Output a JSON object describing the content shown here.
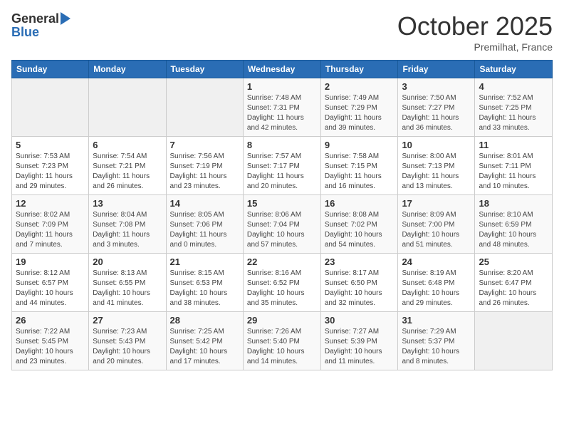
{
  "header": {
    "logo_general": "General",
    "logo_blue": "Blue",
    "month_title": "October 2025",
    "location": "Premilhat, France"
  },
  "days_of_week": [
    "Sunday",
    "Monday",
    "Tuesday",
    "Wednesday",
    "Thursday",
    "Friday",
    "Saturday"
  ],
  "weeks": [
    [
      {
        "day": "",
        "info": ""
      },
      {
        "day": "",
        "info": ""
      },
      {
        "day": "",
        "info": ""
      },
      {
        "day": "1",
        "info": "Sunrise: 7:48 AM\nSunset: 7:31 PM\nDaylight: 11 hours and 42 minutes."
      },
      {
        "day": "2",
        "info": "Sunrise: 7:49 AM\nSunset: 7:29 PM\nDaylight: 11 hours and 39 minutes."
      },
      {
        "day": "3",
        "info": "Sunrise: 7:50 AM\nSunset: 7:27 PM\nDaylight: 11 hours and 36 minutes."
      },
      {
        "day": "4",
        "info": "Sunrise: 7:52 AM\nSunset: 7:25 PM\nDaylight: 11 hours and 33 minutes."
      }
    ],
    [
      {
        "day": "5",
        "info": "Sunrise: 7:53 AM\nSunset: 7:23 PM\nDaylight: 11 hours and 29 minutes."
      },
      {
        "day": "6",
        "info": "Sunrise: 7:54 AM\nSunset: 7:21 PM\nDaylight: 11 hours and 26 minutes."
      },
      {
        "day": "7",
        "info": "Sunrise: 7:56 AM\nSunset: 7:19 PM\nDaylight: 11 hours and 23 minutes."
      },
      {
        "day": "8",
        "info": "Sunrise: 7:57 AM\nSunset: 7:17 PM\nDaylight: 11 hours and 20 minutes."
      },
      {
        "day": "9",
        "info": "Sunrise: 7:58 AM\nSunset: 7:15 PM\nDaylight: 11 hours and 16 minutes."
      },
      {
        "day": "10",
        "info": "Sunrise: 8:00 AM\nSunset: 7:13 PM\nDaylight: 11 hours and 13 minutes."
      },
      {
        "day": "11",
        "info": "Sunrise: 8:01 AM\nSunset: 7:11 PM\nDaylight: 11 hours and 10 minutes."
      }
    ],
    [
      {
        "day": "12",
        "info": "Sunrise: 8:02 AM\nSunset: 7:09 PM\nDaylight: 11 hours and 7 minutes."
      },
      {
        "day": "13",
        "info": "Sunrise: 8:04 AM\nSunset: 7:08 PM\nDaylight: 11 hours and 3 minutes."
      },
      {
        "day": "14",
        "info": "Sunrise: 8:05 AM\nSunset: 7:06 PM\nDaylight: 11 hours and 0 minutes."
      },
      {
        "day": "15",
        "info": "Sunrise: 8:06 AM\nSunset: 7:04 PM\nDaylight: 10 hours and 57 minutes."
      },
      {
        "day": "16",
        "info": "Sunrise: 8:08 AM\nSunset: 7:02 PM\nDaylight: 10 hours and 54 minutes."
      },
      {
        "day": "17",
        "info": "Sunrise: 8:09 AM\nSunset: 7:00 PM\nDaylight: 10 hours and 51 minutes."
      },
      {
        "day": "18",
        "info": "Sunrise: 8:10 AM\nSunset: 6:59 PM\nDaylight: 10 hours and 48 minutes."
      }
    ],
    [
      {
        "day": "19",
        "info": "Sunrise: 8:12 AM\nSunset: 6:57 PM\nDaylight: 10 hours and 44 minutes."
      },
      {
        "day": "20",
        "info": "Sunrise: 8:13 AM\nSunset: 6:55 PM\nDaylight: 10 hours and 41 minutes."
      },
      {
        "day": "21",
        "info": "Sunrise: 8:15 AM\nSunset: 6:53 PM\nDaylight: 10 hours and 38 minutes."
      },
      {
        "day": "22",
        "info": "Sunrise: 8:16 AM\nSunset: 6:52 PM\nDaylight: 10 hours and 35 minutes."
      },
      {
        "day": "23",
        "info": "Sunrise: 8:17 AM\nSunset: 6:50 PM\nDaylight: 10 hours and 32 minutes."
      },
      {
        "day": "24",
        "info": "Sunrise: 8:19 AM\nSunset: 6:48 PM\nDaylight: 10 hours and 29 minutes."
      },
      {
        "day": "25",
        "info": "Sunrise: 8:20 AM\nSunset: 6:47 PM\nDaylight: 10 hours and 26 minutes."
      }
    ],
    [
      {
        "day": "26",
        "info": "Sunrise: 7:22 AM\nSunset: 5:45 PM\nDaylight: 10 hours and 23 minutes."
      },
      {
        "day": "27",
        "info": "Sunrise: 7:23 AM\nSunset: 5:43 PM\nDaylight: 10 hours and 20 minutes."
      },
      {
        "day": "28",
        "info": "Sunrise: 7:25 AM\nSunset: 5:42 PM\nDaylight: 10 hours and 17 minutes."
      },
      {
        "day": "29",
        "info": "Sunrise: 7:26 AM\nSunset: 5:40 PM\nDaylight: 10 hours and 14 minutes."
      },
      {
        "day": "30",
        "info": "Sunrise: 7:27 AM\nSunset: 5:39 PM\nDaylight: 10 hours and 11 minutes."
      },
      {
        "day": "31",
        "info": "Sunrise: 7:29 AM\nSunset: 5:37 PM\nDaylight: 10 hours and 8 minutes."
      },
      {
        "day": "",
        "info": ""
      }
    ]
  ]
}
